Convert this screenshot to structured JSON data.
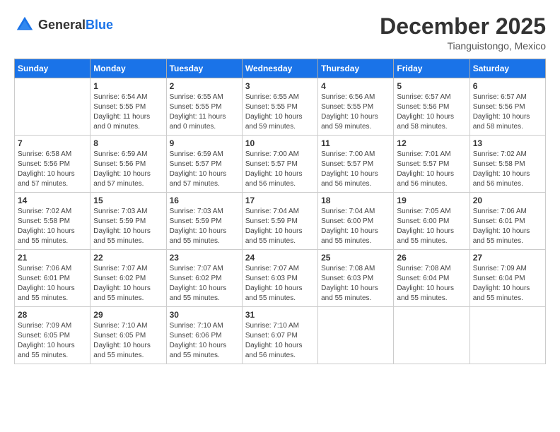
{
  "logo": {
    "general": "General",
    "blue": "Blue"
  },
  "header": {
    "month": "December 2025",
    "location": "Tianguistongo, Mexico"
  },
  "weekdays": [
    "Sunday",
    "Monday",
    "Tuesday",
    "Wednesday",
    "Thursday",
    "Friday",
    "Saturday"
  ],
  "weeks": [
    [
      {
        "day": "",
        "info": ""
      },
      {
        "day": "1",
        "info": "Sunrise: 6:54 AM\nSunset: 5:55 PM\nDaylight: 11 hours\nand 0 minutes."
      },
      {
        "day": "2",
        "info": "Sunrise: 6:55 AM\nSunset: 5:55 PM\nDaylight: 11 hours\nand 0 minutes."
      },
      {
        "day": "3",
        "info": "Sunrise: 6:55 AM\nSunset: 5:55 PM\nDaylight: 10 hours\nand 59 minutes."
      },
      {
        "day": "4",
        "info": "Sunrise: 6:56 AM\nSunset: 5:55 PM\nDaylight: 10 hours\nand 59 minutes."
      },
      {
        "day": "5",
        "info": "Sunrise: 6:57 AM\nSunset: 5:56 PM\nDaylight: 10 hours\nand 58 minutes."
      },
      {
        "day": "6",
        "info": "Sunrise: 6:57 AM\nSunset: 5:56 PM\nDaylight: 10 hours\nand 58 minutes."
      }
    ],
    [
      {
        "day": "7",
        "info": "Sunrise: 6:58 AM\nSunset: 5:56 PM\nDaylight: 10 hours\nand 57 minutes."
      },
      {
        "day": "8",
        "info": "Sunrise: 6:59 AM\nSunset: 5:56 PM\nDaylight: 10 hours\nand 57 minutes."
      },
      {
        "day": "9",
        "info": "Sunrise: 6:59 AM\nSunset: 5:57 PM\nDaylight: 10 hours\nand 57 minutes."
      },
      {
        "day": "10",
        "info": "Sunrise: 7:00 AM\nSunset: 5:57 PM\nDaylight: 10 hours\nand 56 minutes."
      },
      {
        "day": "11",
        "info": "Sunrise: 7:00 AM\nSunset: 5:57 PM\nDaylight: 10 hours\nand 56 minutes."
      },
      {
        "day": "12",
        "info": "Sunrise: 7:01 AM\nSunset: 5:57 PM\nDaylight: 10 hours\nand 56 minutes."
      },
      {
        "day": "13",
        "info": "Sunrise: 7:02 AM\nSunset: 5:58 PM\nDaylight: 10 hours\nand 56 minutes."
      }
    ],
    [
      {
        "day": "14",
        "info": "Sunrise: 7:02 AM\nSunset: 5:58 PM\nDaylight: 10 hours\nand 55 minutes."
      },
      {
        "day": "15",
        "info": "Sunrise: 7:03 AM\nSunset: 5:59 PM\nDaylight: 10 hours\nand 55 minutes."
      },
      {
        "day": "16",
        "info": "Sunrise: 7:03 AM\nSunset: 5:59 PM\nDaylight: 10 hours\nand 55 minutes."
      },
      {
        "day": "17",
        "info": "Sunrise: 7:04 AM\nSunset: 5:59 PM\nDaylight: 10 hours\nand 55 minutes."
      },
      {
        "day": "18",
        "info": "Sunrise: 7:04 AM\nSunset: 6:00 PM\nDaylight: 10 hours\nand 55 minutes."
      },
      {
        "day": "19",
        "info": "Sunrise: 7:05 AM\nSunset: 6:00 PM\nDaylight: 10 hours\nand 55 minutes."
      },
      {
        "day": "20",
        "info": "Sunrise: 7:06 AM\nSunset: 6:01 PM\nDaylight: 10 hours\nand 55 minutes."
      }
    ],
    [
      {
        "day": "21",
        "info": "Sunrise: 7:06 AM\nSunset: 6:01 PM\nDaylight: 10 hours\nand 55 minutes."
      },
      {
        "day": "22",
        "info": "Sunrise: 7:07 AM\nSunset: 6:02 PM\nDaylight: 10 hours\nand 55 minutes."
      },
      {
        "day": "23",
        "info": "Sunrise: 7:07 AM\nSunset: 6:02 PM\nDaylight: 10 hours\nand 55 minutes."
      },
      {
        "day": "24",
        "info": "Sunrise: 7:07 AM\nSunset: 6:03 PM\nDaylight: 10 hours\nand 55 minutes."
      },
      {
        "day": "25",
        "info": "Sunrise: 7:08 AM\nSunset: 6:03 PM\nDaylight: 10 hours\nand 55 minutes."
      },
      {
        "day": "26",
        "info": "Sunrise: 7:08 AM\nSunset: 6:04 PM\nDaylight: 10 hours\nand 55 minutes."
      },
      {
        "day": "27",
        "info": "Sunrise: 7:09 AM\nSunset: 6:04 PM\nDaylight: 10 hours\nand 55 minutes."
      }
    ],
    [
      {
        "day": "28",
        "info": "Sunrise: 7:09 AM\nSunset: 6:05 PM\nDaylight: 10 hours\nand 55 minutes."
      },
      {
        "day": "29",
        "info": "Sunrise: 7:10 AM\nSunset: 6:05 PM\nDaylight: 10 hours\nand 55 minutes."
      },
      {
        "day": "30",
        "info": "Sunrise: 7:10 AM\nSunset: 6:06 PM\nDaylight: 10 hours\nand 55 minutes."
      },
      {
        "day": "31",
        "info": "Sunrise: 7:10 AM\nSunset: 6:07 PM\nDaylight: 10 hours\nand 56 minutes."
      },
      {
        "day": "",
        "info": ""
      },
      {
        "day": "",
        "info": ""
      },
      {
        "day": "",
        "info": ""
      }
    ]
  ]
}
